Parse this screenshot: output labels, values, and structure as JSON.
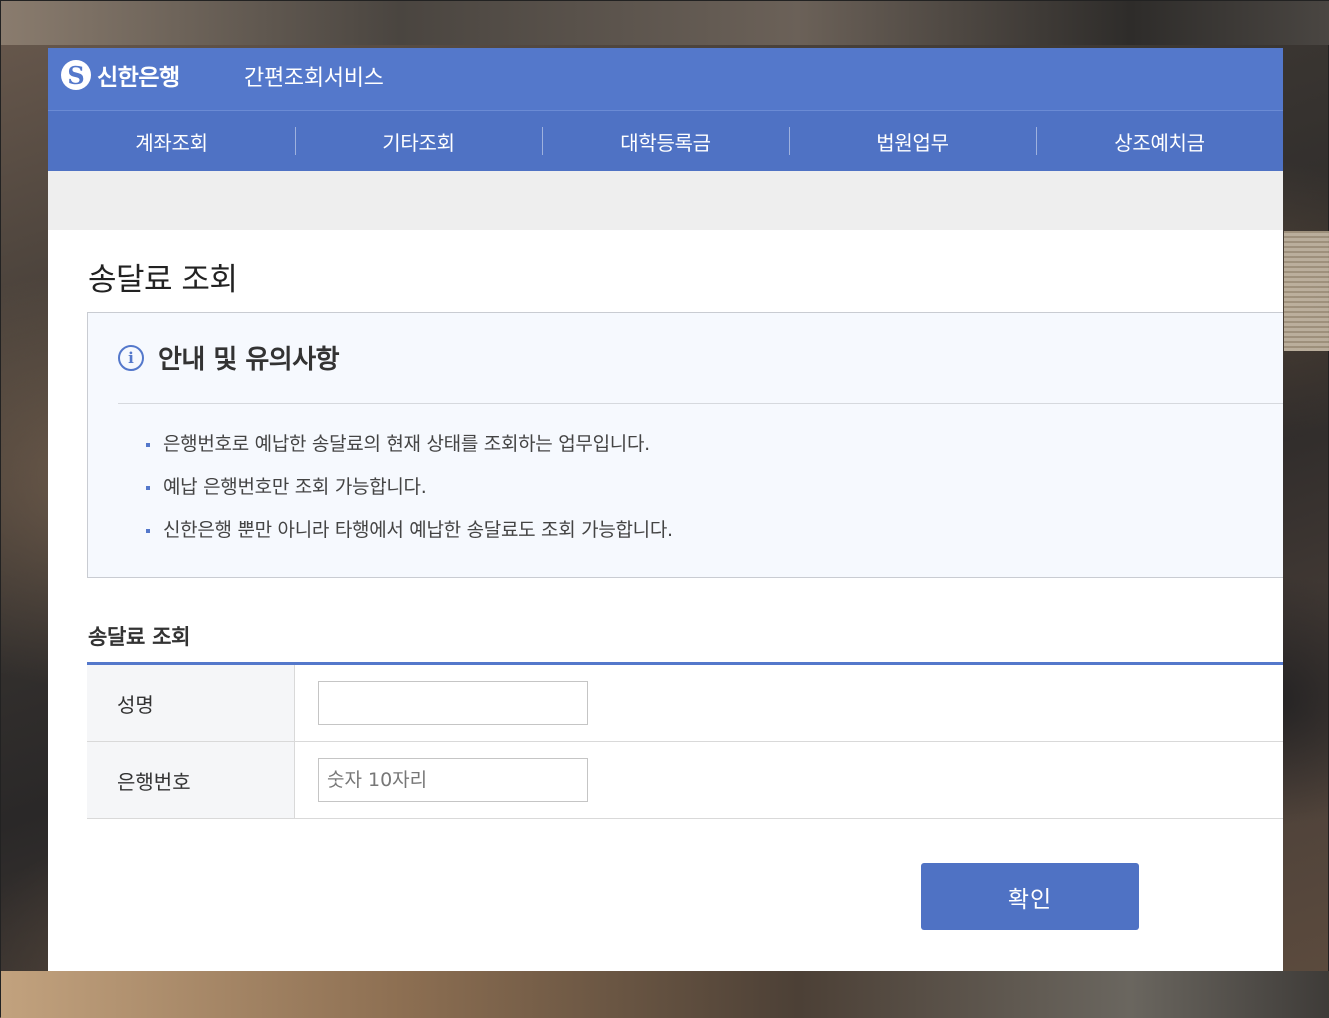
{
  "header": {
    "logo_mark": "S",
    "bank_name": "신한은행",
    "service_title": "간편조회서비스"
  },
  "nav": {
    "items": [
      {
        "label": "계좌조회"
      },
      {
        "label": "기타조회"
      },
      {
        "label": "대학등록금"
      },
      {
        "label": "법원업무"
      },
      {
        "label": "상조예치금"
      }
    ]
  },
  "page": {
    "title": "송달료 조회"
  },
  "notice": {
    "icon_glyph": "i",
    "title": "안내 및 유의사항",
    "items": [
      "은행번호로 예납한 송달료의 현재 상태를 조회하는 업무입니다.",
      "예납 은행번호만 조회 가능합니다.",
      "신한은행 뿐만 아니라 타행에서 예납한 송달료도 조회 가능합니다."
    ]
  },
  "form": {
    "title": "송달료 조회",
    "name_label": "성명",
    "name_value": "",
    "account_label": "은행번호",
    "account_value": "",
    "account_placeholder": "숫자 10자리"
  },
  "actions": {
    "confirm_label": "확인"
  },
  "colors": {
    "brand": "#5478cb",
    "nav": "#4f72c4",
    "button": "#4f72c4"
  }
}
